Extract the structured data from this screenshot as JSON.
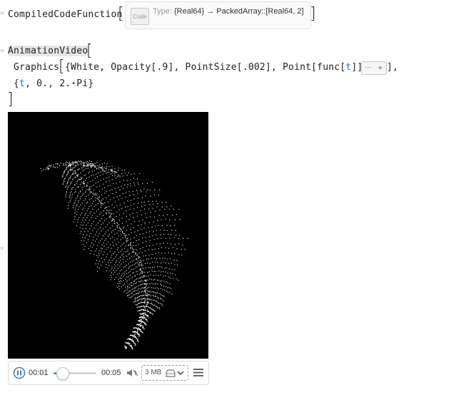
{
  "cell1": {
    "prefix": "CompiledCodeFunction",
    "code_icon_label": "Code",
    "type_key": "Type:",
    "type_value": "{Real64} → PackedArray::[Real64, 2]"
  },
  "cell2": {
    "function": "AnimationVideo",
    "line2_graphics": "Graphics",
    "line2_args": "{White, Opacity[.9], PointSize[.002], Point[func[",
    "line2_var": "t",
    "line2_close": "]]},",
    "elide_dots": "···",
    "elide_plus": "+",
    "line2_after": "],",
    "line3_open": "{",
    "line3_var": "t",
    "line3_rest": ", 0., 2.⋆Pi}"
  },
  "player": {
    "current_time": "00:01",
    "end_time": "00:05",
    "size": "3 MB",
    "progress_fraction": 0.2
  },
  "colors": {
    "video_bg": "#000000",
    "points": "#ffffff",
    "var_blue": "#3b6aa5"
  },
  "icons": [
    "pause-icon",
    "mute-icon",
    "export-icon",
    "chevron-down-icon",
    "menu-icon"
  ]
}
